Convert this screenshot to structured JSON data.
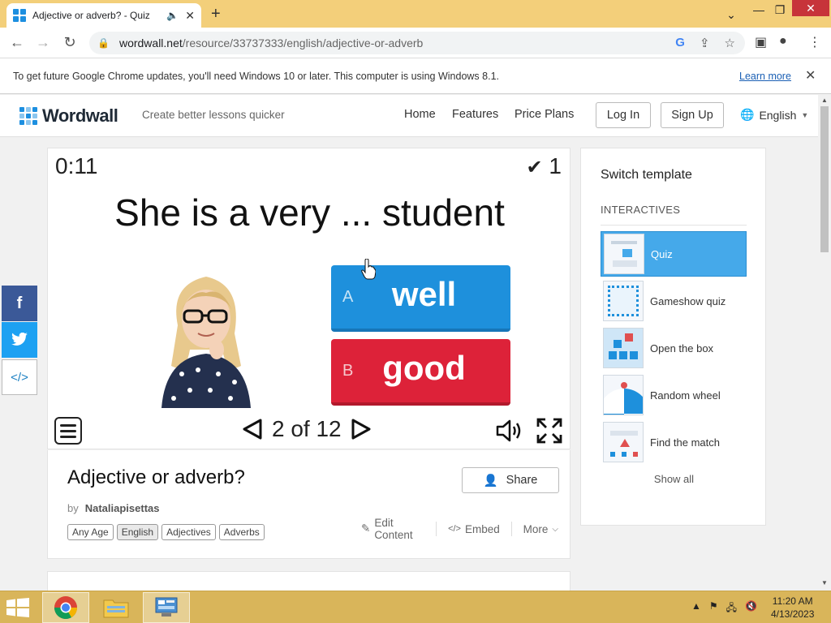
{
  "browser": {
    "tab_title": "Adjective or adverb? - Quiz",
    "new_tab": "+",
    "url_host": "wordwall.net",
    "url_path": "/resource/33737333/english/adjective-or-adverb"
  },
  "infobar": {
    "message": "To get future Google Chrome updates, you'll need Windows 10 or later. This computer is using Windows 8.1.",
    "link": "Learn more"
  },
  "site": {
    "logo": "Wordwall",
    "tagline": "Create better lessons quicker",
    "nav": {
      "home": "Home",
      "features": "Features",
      "pricing": "Price Plans"
    },
    "login": "Log In",
    "signup": "Sign Up",
    "language": "English"
  },
  "game": {
    "timer": "0:11",
    "score": "1",
    "question": "She is a very ... student",
    "answers": [
      {
        "letter": "A",
        "text": "well"
      },
      {
        "letter": "B",
        "text": "good"
      }
    ],
    "progress": "2 of 12"
  },
  "activity": {
    "title": "Adjective or adverb?",
    "by_label": "by",
    "author": "Nataliapisettas",
    "share": "Share",
    "tags": [
      "Any Age",
      "English",
      "Adjectives",
      "Adverbs"
    ],
    "actions": {
      "edit": "Edit Content",
      "embed": "Embed",
      "more": "More"
    }
  },
  "sidebar": {
    "title": "Switch template",
    "section": "INTERACTIVES",
    "templates": [
      {
        "label": "Quiz",
        "icon": "quiz-icon"
      },
      {
        "label": "Gameshow quiz",
        "icon": "gameshow-icon"
      },
      {
        "label": "Open the box",
        "icon": "open-box-icon"
      },
      {
        "label": "Random wheel",
        "icon": "wheel-icon"
      },
      {
        "label": "Find the match",
        "icon": "match-icon"
      }
    ],
    "show_all": "Show all"
  },
  "taskbar": {
    "time": "11:20 AM",
    "date": "4/13/2023"
  },
  "colors": {
    "tabstrip": "#f3cf7a",
    "answer_a": "#1e90dc",
    "answer_b": "#dd2239",
    "template_active": "#45a9ea",
    "taskbar": "#d9b55a"
  }
}
